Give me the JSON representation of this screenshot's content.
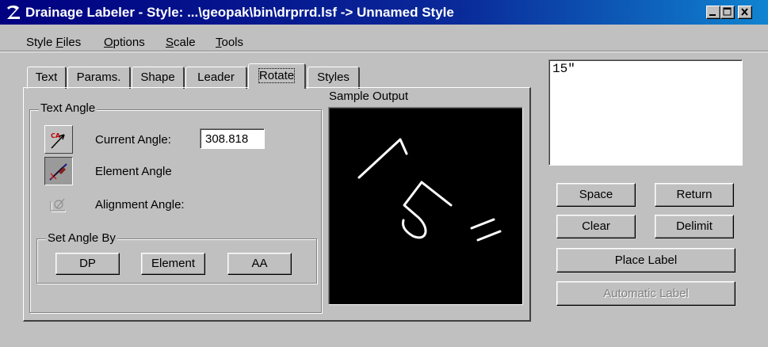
{
  "window": {
    "title": "Drainage Labeler - Style: ...\\geopak\\bin\\drprrd.lsf -> Unnamed Style",
    "icon": "geopak-logo-icon"
  },
  "caption_buttons": [
    "minimize",
    "maximize",
    "close"
  ],
  "menu": [
    {
      "label_prefix": "Style ",
      "label_mnemonic": "F",
      "label_suffix": "iles"
    },
    {
      "label_prefix": "",
      "label_mnemonic": "O",
      "label_suffix": "ptions"
    },
    {
      "label_prefix": "",
      "label_mnemonic": "S",
      "label_suffix": "cale"
    },
    {
      "label_prefix": "",
      "label_mnemonic": "T",
      "label_suffix": "ools"
    }
  ],
  "tabs": [
    {
      "label": "Text",
      "active": false
    },
    {
      "label": "Params.",
      "active": false
    },
    {
      "label": "Shape",
      "active": false
    },
    {
      "label": "Leader",
      "active": false
    },
    {
      "label": "Rotate",
      "active": true
    },
    {
      "label": "Styles",
      "active": false
    }
  ],
  "text_angle": {
    "group_label": "Text Angle",
    "current_angle_label": "Current Angle:",
    "current_angle_value": "308.818",
    "element_angle_label": "Element Angle",
    "alignment_angle_label": "Alignment Angle:",
    "icons": {
      "current": "current-angle-icon",
      "element": "element-angle-icon",
      "alignment": "alignment-angle-icon"
    },
    "selected_mode": "element"
  },
  "set_angle_by": {
    "group_label": "Set Angle By",
    "buttons": [
      "DP",
      "Element",
      "AA"
    ]
  },
  "sample_output": {
    "label": "Sample Output",
    "text": "15\"",
    "rotation_deg": 308.818,
    "background": "#000000",
    "stroke": "#ffffff"
  },
  "label_text": {
    "value": "15\""
  },
  "actions": {
    "space": "Space",
    "return": "Return",
    "clear": "Clear",
    "delimit": "Delimit",
    "place_label": "Place Label",
    "automatic_label": "Automatic Label",
    "automatic_label_enabled": false
  },
  "colors": {
    "face": "#c0c0c0",
    "title_start": "#000080",
    "title_end": "#1084d0",
    "sample_bg": "#000000"
  }
}
